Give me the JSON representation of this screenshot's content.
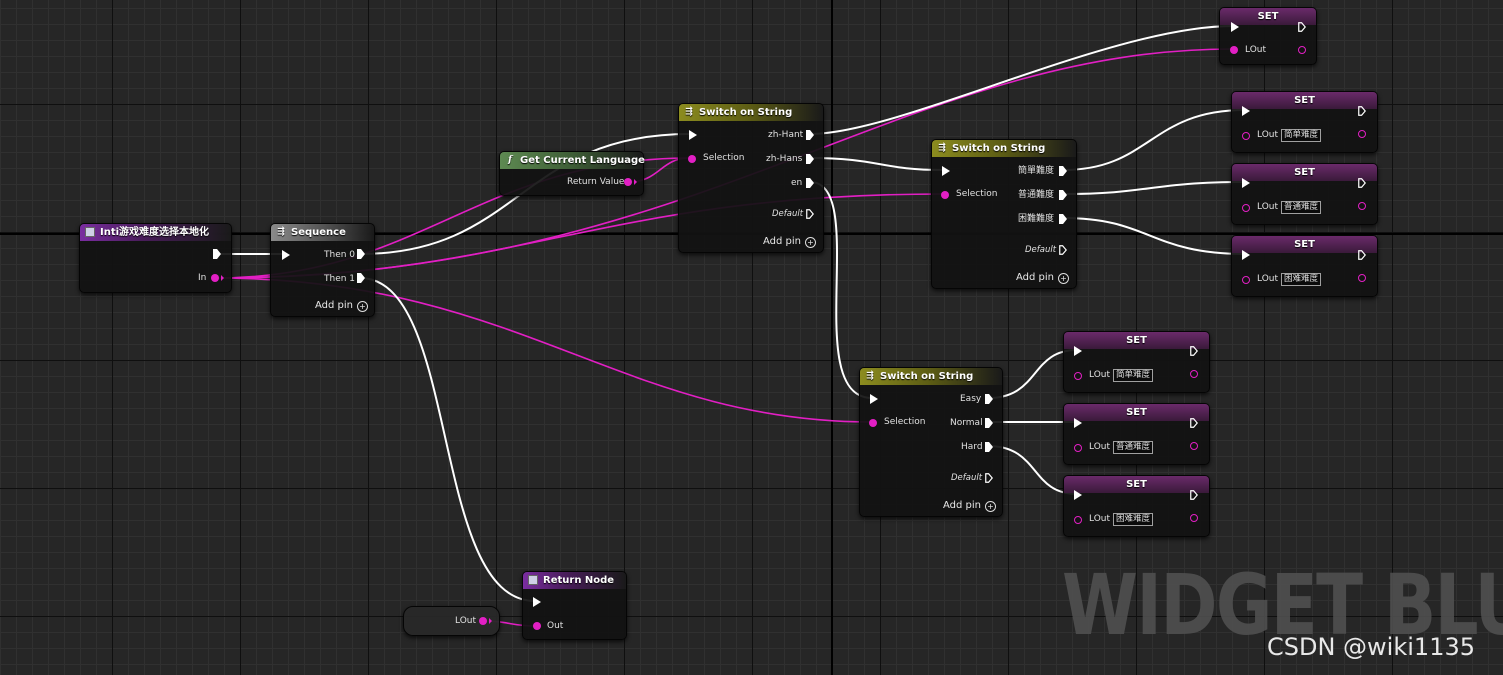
{
  "colors": {
    "exec_wire": "#ffffff",
    "string_wire": "#e21fc4",
    "background": "#262626"
  },
  "watermark": "WIDGET BLU",
  "credit": "CSDN @wiki1135",
  "entry": {
    "title": "Inti游戏难度选择本地化",
    "in_label": "In"
  },
  "sequence": {
    "title": "Sequence",
    "then0": "Then 0",
    "then1": "Then 1",
    "add_pin": "Add pin"
  },
  "get_lang": {
    "title": "Get Current Language",
    "return_value": "Return Value"
  },
  "switch1": {
    "title": "Switch on String",
    "selection": "Selection",
    "cases": [
      "zh-Hant",
      "zh-Hans",
      "en"
    ],
    "default": "Default",
    "add_pin": "Add pin"
  },
  "switch2": {
    "title": "Switch on String",
    "selection": "Selection",
    "cases": [
      "簡單難度",
      "普通難度",
      "困難難度"
    ],
    "default": "Default",
    "add_pin": "Add pin"
  },
  "switch3": {
    "title": "Switch on String",
    "selection": "Selection",
    "cases": [
      "Easy",
      "Normal",
      "Hard"
    ],
    "default": "Default",
    "add_pin": "Add pin"
  },
  "set_top": {
    "title": "SET",
    "var": "LOut"
  },
  "set_nodes": [
    {
      "title": "SET",
      "var": "LOut",
      "value": "简单难度"
    },
    {
      "title": "SET",
      "var": "LOut",
      "value": "普通难度"
    },
    {
      "title": "SET",
      "var": "LOut",
      "value": "困难难度"
    },
    {
      "title": "SET",
      "var": "LOut",
      "value": "简单难度"
    },
    {
      "title": "SET",
      "var": "LOut",
      "value": "普通难度"
    },
    {
      "title": "SET",
      "var": "LOut",
      "value": "困难难度"
    }
  ],
  "lout_var": {
    "label": "LOut"
  },
  "return_node": {
    "title": "Return Node",
    "out": "Out"
  }
}
